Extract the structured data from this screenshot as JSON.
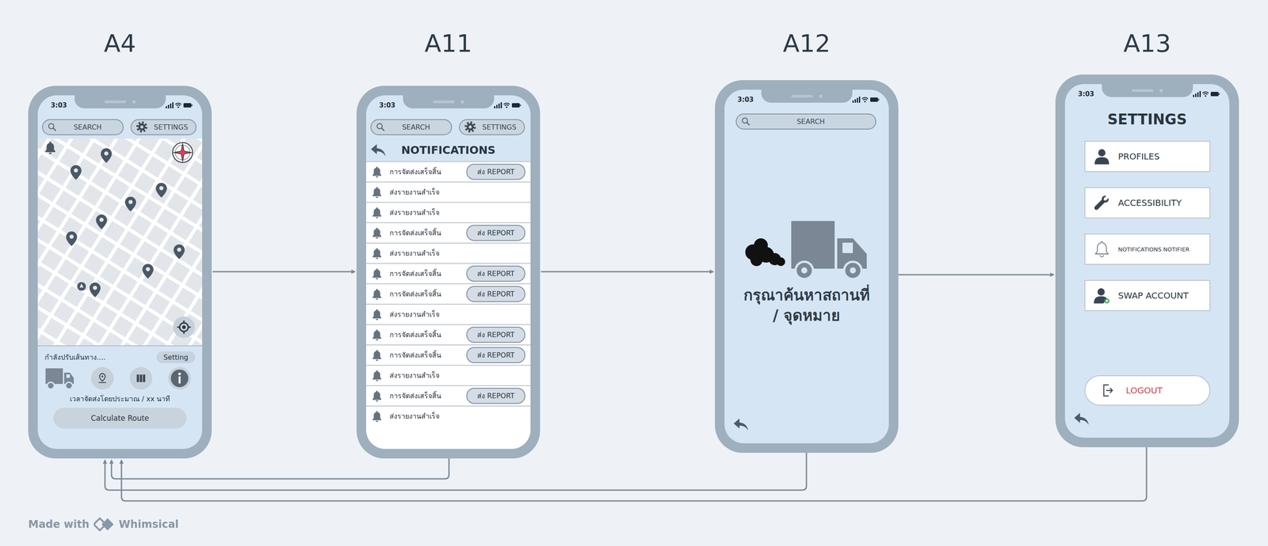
{
  "screens": {
    "a4": {
      "label": "A4",
      "time": "3:03",
      "search": {
        "placeholder": "SEARCH"
      },
      "settings_button": "SETTINGS",
      "route_status": "กำลังปรับเส้นทาง....",
      "setting_button": "Setting",
      "eta": "เวลาจัดส่งโดยประมาณ / xx นาที",
      "calculate_button": "Calculate Route"
    },
    "a11": {
      "label": "A11",
      "time": "3:03",
      "search": {
        "placeholder": "SEARCH"
      },
      "settings_button": "SETTINGS",
      "title": "NOTIFICATIONS",
      "notifications": [
        {
          "kind": "report",
          "text": "การจัดส่งเสร็จสิ้น",
          "button": "ส่ง REPORT"
        },
        {
          "kind": "plain",
          "text": "ส่งรายงานสำเร็จ"
        },
        {
          "kind": "plain",
          "text": "ส่งรายงานสำเร็จ"
        },
        {
          "kind": "report",
          "text": "การจัดส่งเสร็จสิ้น",
          "button": "ส่ง REPORT"
        },
        {
          "kind": "plain",
          "text": "ส่งรายงานสำเร็จ"
        },
        {
          "kind": "report",
          "text": "การจัดส่งเสร็จสิ้น",
          "button": "ส่ง REPORT"
        },
        {
          "kind": "report",
          "text": "การจัดส่งเสร็จสิ้น",
          "button": "ส่ง REPORT"
        },
        {
          "kind": "plain",
          "text": "ส่งรายงานสำเร็จ"
        },
        {
          "kind": "report",
          "text": "การจัดส่งเสร็จสิ้น",
          "button": "ส่ง REPORT"
        },
        {
          "kind": "report",
          "text": "การจัดส่งเสร็จสิ้น",
          "button": "ส่ง REPORT"
        },
        {
          "kind": "plain",
          "text": "ส่งรายงานสำเร็จ"
        },
        {
          "kind": "report",
          "text": "การจัดส่งเสร็จสิ้น",
          "button": "ส่ง REPORT"
        },
        {
          "kind": "plain",
          "text": "ส่งรายงานสำเร็จ"
        }
      ]
    },
    "a12": {
      "label": "A12",
      "time": "3:03",
      "search": {
        "placeholder": "SEARCH"
      },
      "message": [
        "กรุณาค้นหาสถานที่",
        "/ จุดหมาย"
      ]
    },
    "a13": {
      "label": "A13",
      "time": "3:03",
      "title": "SETTINGS",
      "items": [
        {
          "label": "PROFILES"
        },
        {
          "label": "ACCESSIBILITY"
        },
        {
          "label": "NOTIFICATIONS NOTIFIER"
        },
        {
          "label": "SWAP ACCOUNT"
        }
      ],
      "logout_button": "LOGOUT"
    }
  },
  "footer": {
    "made_with": "Made with",
    "brand": "Whimsical"
  }
}
